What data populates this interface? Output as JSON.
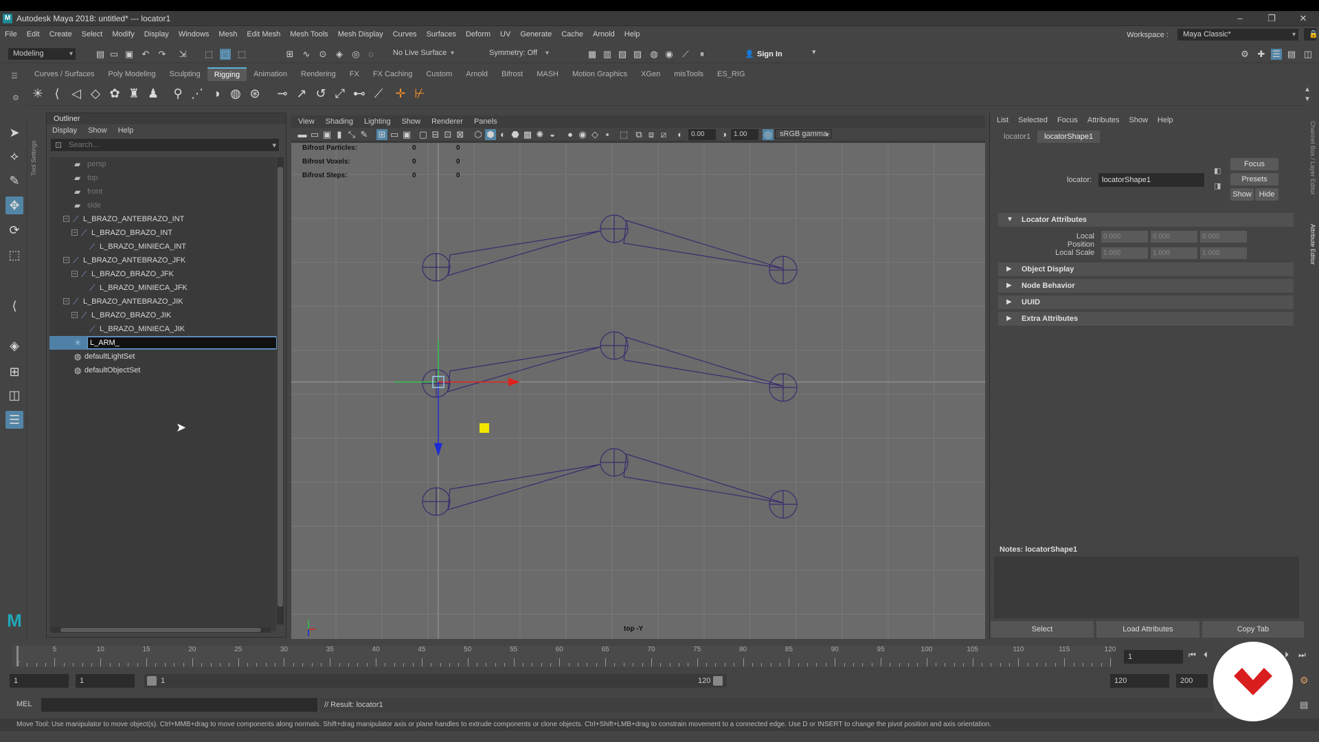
{
  "app": {
    "title": "Autodesk Maya 2018: untitled*   ---   locator1",
    "logo_letter": "M",
    "window_controls": [
      "–",
      "❐",
      "✕"
    ]
  },
  "menubar": {
    "items": [
      "File",
      "Edit",
      "Create",
      "Select",
      "Modify",
      "Display",
      "Windows",
      "Mesh",
      "Edit Mesh",
      "Mesh Tools",
      "Mesh Display",
      "Curves",
      "Surfaces",
      "Deform",
      "UV",
      "Generate",
      "Cache",
      "Arnold",
      "Help"
    ],
    "workspace_label": "Workspace :",
    "workspace_value": "Maya Classic*"
  },
  "toolbar": {
    "mode": "Modeling",
    "live_surface": "No Live Surface",
    "symmetry": "Symmetry: Off",
    "sign_in": "Sign In"
  },
  "shelf": {
    "tabs": [
      "Curves / Surfaces",
      "Poly Modeling",
      "Sculpting",
      "Rigging",
      "Animation",
      "Rendering",
      "FX",
      "FX Caching",
      "Custom",
      "Arnold",
      "Bifrost",
      "MASH",
      "Motion Graphics",
      "XGen",
      "misTools",
      "ES_RIG"
    ],
    "active_tab": "Rigging"
  },
  "toolbox": {
    "side_label": "Tool Settings"
  },
  "outliner": {
    "title": "Outliner",
    "menu": [
      "Display",
      "Show",
      "Help"
    ],
    "search_placeholder": "Search...",
    "rows": [
      {
        "label": "persp",
        "depth": 1,
        "icon": "camera-icon",
        "dim": true
      },
      {
        "label": "top",
        "depth": 1,
        "icon": "camera-icon",
        "dim": true
      },
      {
        "label": "front",
        "depth": 1,
        "icon": "camera-icon",
        "dim": true
      },
      {
        "label": "side",
        "depth": 1,
        "icon": "camera-icon",
        "dim": true
      },
      {
        "label": "L_BRAZO_ANTEBRAZO_INT",
        "depth": 0,
        "icon": "joint-icon",
        "expand": "−"
      },
      {
        "label": "L_BRAZO_BRAZO_INT",
        "depth": 1,
        "icon": "joint-icon",
        "expand": "−"
      },
      {
        "label": "L_BRAZO_MINIECA_INT",
        "depth": 2,
        "icon": "joint-icon"
      },
      {
        "label": "L_BRAZO_ANTEBRAZO_JFK",
        "depth": 0,
        "icon": "joint-icon",
        "expand": "−"
      },
      {
        "label": "L_BRAZO_BRAZO_JFK",
        "depth": 1,
        "icon": "joint-icon",
        "expand": "−"
      },
      {
        "label": "L_BRAZO_MINIECA_JFK",
        "depth": 2,
        "icon": "joint-icon"
      },
      {
        "label": "L_BRAZO_ANTEBRAZO_JIK",
        "depth": 0,
        "icon": "joint-icon",
        "expand": "−"
      },
      {
        "label": "L_BRAZO_BRAZO_JIK",
        "depth": 1,
        "icon": "joint-icon",
        "expand": "−"
      },
      {
        "label": "L_BRAZO_MINIECA_JIK",
        "depth": 2,
        "icon": "joint-icon"
      },
      {
        "label": "L_ARM_",
        "depth": 1,
        "icon": "locator-icon",
        "editing": true
      },
      {
        "label": "defaultLightSet",
        "depth": 1,
        "icon": "set-icon"
      },
      {
        "label": "defaultObjectSet",
        "depth": 1,
        "icon": "set-icon"
      }
    ]
  },
  "viewport": {
    "menu": [
      "View",
      "Shading",
      "Lighting",
      "Show",
      "Renderer",
      "Panels"
    ],
    "camera_label": "top -Y",
    "exposure": "0.00",
    "gamma": "1.00",
    "color_space": "sRGB gamma",
    "hud": [
      {
        "label": "Bifrost Particles:",
        "v1": "0",
        "v2": "0"
      },
      {
        "label": "Bifrost Voxels:",
        "v1": "0",
        "v2": "0"
      },
      {
        "label": "Bifrost Steps:",
        "v1": "0",
        "v2": "0"
      }
    ]
  },
  "attribute_editor": {
    "menu": [
      "List",
      "Selected",
      "Focus",
      "Attributes",
      "Show",
      "Help"
    ],
    "tabs": [
      "locator1",
      "locatorShape1"
    ],
    "active_tab": "locatorShape1",
    "locator_label": "locator:",
    "locator_value": "locatorShape1",
    "buttons": {
      "focus": "Focus",
      "presets": "Presets",
      "show": "Show",
      "hide": "Hide"
    },
    "sections": {
      "locator_attributes": "Locator Attributes",
      "object_display": "Object Display",
      "node_behavior": "Node Behavior",
      "uuid": "UUID",
      "extra_attributes": "Extra Attributes"
    },
    "local_position_label": "Local Position",
    "local_position": [
      "0.000",
      "0.000",
      "0.000"
    ],
    "local_scale_label": "Local Scale",
    "local_scale": [
      "1.000",
      "1.000",
      "1.000"
    ],
    "notes_label": "Notes:  locatorShape1",
    "side_tabs": [
      "Channel Box / Layer Editor",
      "Attribute Editor"
    ],
    "bottom_buttons": [
      "Select",
      "Load Attributes",
      "Copy Tab"
    ]
  },
  "timeline": {
    "ticks": [
      "5",
      "10",
      "15",
      "20",
      "25",
      "30",
      "35",
      "40",
      "45",
      "50",
      "55",
      "60",
      "65",
      "70",
      "75",
      "80",
      "85",
      "90",
      "95",
      "100",
      "105",
      "110",
      "115",
      "120"
    ],
    "first_label": "1",
    "current_frame": "1"
  },
  "range": {
    "start": "1",
    "start2": "1",
    "slider_start": "1",
    "slider_end": "120",
    "end": "120",
    "end2": "200"
  },
  "command": {
    "lang": "MEL",
    "result": "// Result: locator1"
  },
  "help_line": "Move Tool: Use manipulator to move object(s). Ctrl+MMB+drag to move components along normals. Shift+drag manipulator axis or plane handles to extrude components or clone objects. Ctrl+Shift+LMB+drag to constrain movement to a connected edge. Use D or INSERT to change the pivot position and axis orientation.",
  "colors": {
    "accent": "#5285a6",
    "joint": "#3a2a6e",
    "locator_yellow": "#f2e600",
    "axis_x": "#e0201c",
    "axis_y": "#2ec04a",
    "axis_z": "#1b2bd6",
    "logo_red": "#d81e1e"
  }
}
